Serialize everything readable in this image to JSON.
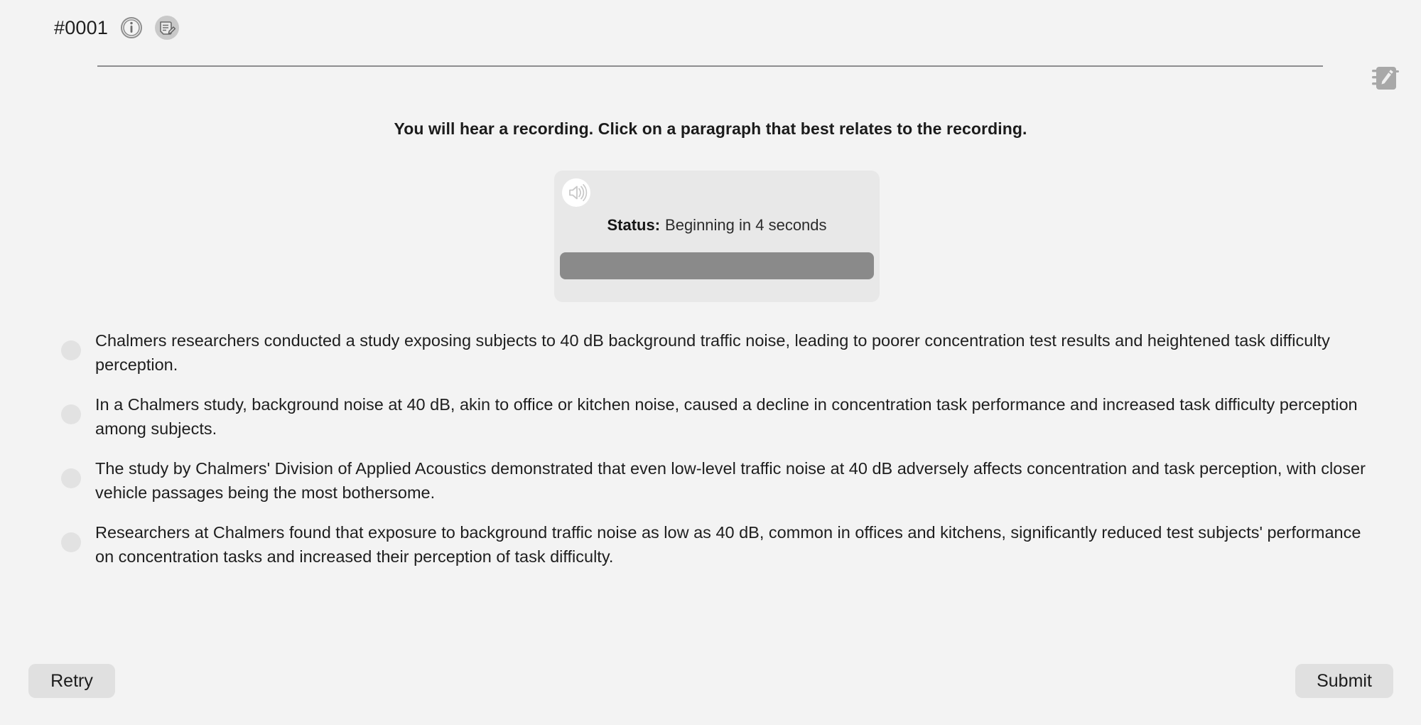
{
  "header": {
    "task_id": "#0001",
    "info_icon": "info-circle-icon",
    "note_icon": "note-edit-icon"
  },
  "floating": {
    "notepad_icon": "notepad-pencil-icon"
  },
  "prompt": {
    "text": "You will hear a recording. Click on a paragraph that best relates to the recording."
  },
  "audio": {
    "speaker_icon": "speaker-volume-icon",
    "status_label": "Status:",
    "status_value": "Beginning in 4 seconds",
    "progress_percent": 100,
    "track_color": "#e0e0e0",
    "fill_color": "#8a8a8a"
  },
  "options": [
    {
      "id": "option-1",
      "text": "Chalmers researchers conducted a study exposing subjects to 40 dB background traffic noise, leading to poorer concentration test results and heightened task difficulty perception.",
      "selected": false
    },
    {
      "id": "option-2",
      "text": "In a Chalmers study, background noise at 40 dB, akin to office or kitchen noise, caused a decline in concentration task performance and increased task difficulty perception among subjects.",
      "selected": false
    },
    {
      "id": "option-3",
      "text": "The study by Chalmers' Division of Applied Acoustics demonstrated that even low-level traffic noise at 40 dB adversely affects concentration and task perception, with closer vehicle passages being the most bothersome.",
      "selected": false
    },
    {
      "id": "option-4",
      "text": "Researchers at Chalmers found that exposure to background traffic noise as low as 40 dB, common in offices and kitchens, significantly reduced test subjects' performance on concentration tasks and increased their perception of task difficulty.",
      "selected": false
    }
  ],
  "footer": {
    "retry_label": "Retry",
    "submit_label": "Submit"
  },
  "colors": {
    "page_background": "#f3f3f3",
    "panel_background": "#e8e8e8",
    "button_background": "#e0e0e0",
    "divider": "#8d8d8f",
    "radio": "#e2e2e2",
    "text": "#1d1d1d"
  }
}
